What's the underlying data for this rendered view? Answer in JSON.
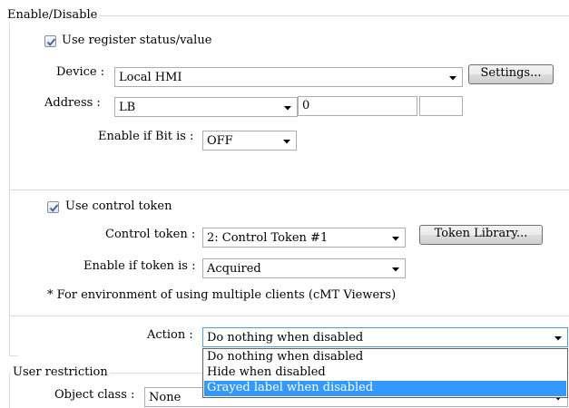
{
  "enable_disable": {
    "legend": "Enable/Disable",
    "use_register_label": "Use register status/value",
    "use_register_checked": true,
    "device_label": "Device :",
    "device_value": "Local HMI",
    "settings_button": "Settings...",
    "address_label": "Address :",
    "address_type_value": "LB",
    "address_value": "0",
    "address_extra_value": "",
    "enable_if_bit_label": "Enable if Bit is :",
    "enable_if_bit_value": "OFF",
    "use_control_token_label": "Use control token",
    "use_control_token_checked": true,
    "control_token_label": "Control token :",
    "control_token_value": "2: Control Token #1",
    "token_library_button": "Token Library...",
    "enable_if_token_label": "Enable if token is :",
    "enable_if_token_value": "Acquired",
    "note": "* For environment of using multiple clients (cMT Viewers)",
    "action_label": "Action :",
    "action_value": "Do nothing when disabled",
    "action_options": [
      "Do nothing when disabled",
      "Hide when disabled",
      "Grayed label when disabled"
    ],
    "action_highlighted_option": "Grayed label when disabled"
  },
  "user_restriction": {
    "legend": "User restriction",
    "object_class_label": "Object class :",
    "object_class_value": "None"
  },
  "icons": {
    "checkbox_check": "check-icon",
    "combo_arrow": "chevron-down-icon"
  },
  "colors": {
    "group_border": "#d5dfe5",
    "selection": "#3399ff",
    "focus_border": "#569de5",
    "check_mark": "#4a5f97"
  }
}
